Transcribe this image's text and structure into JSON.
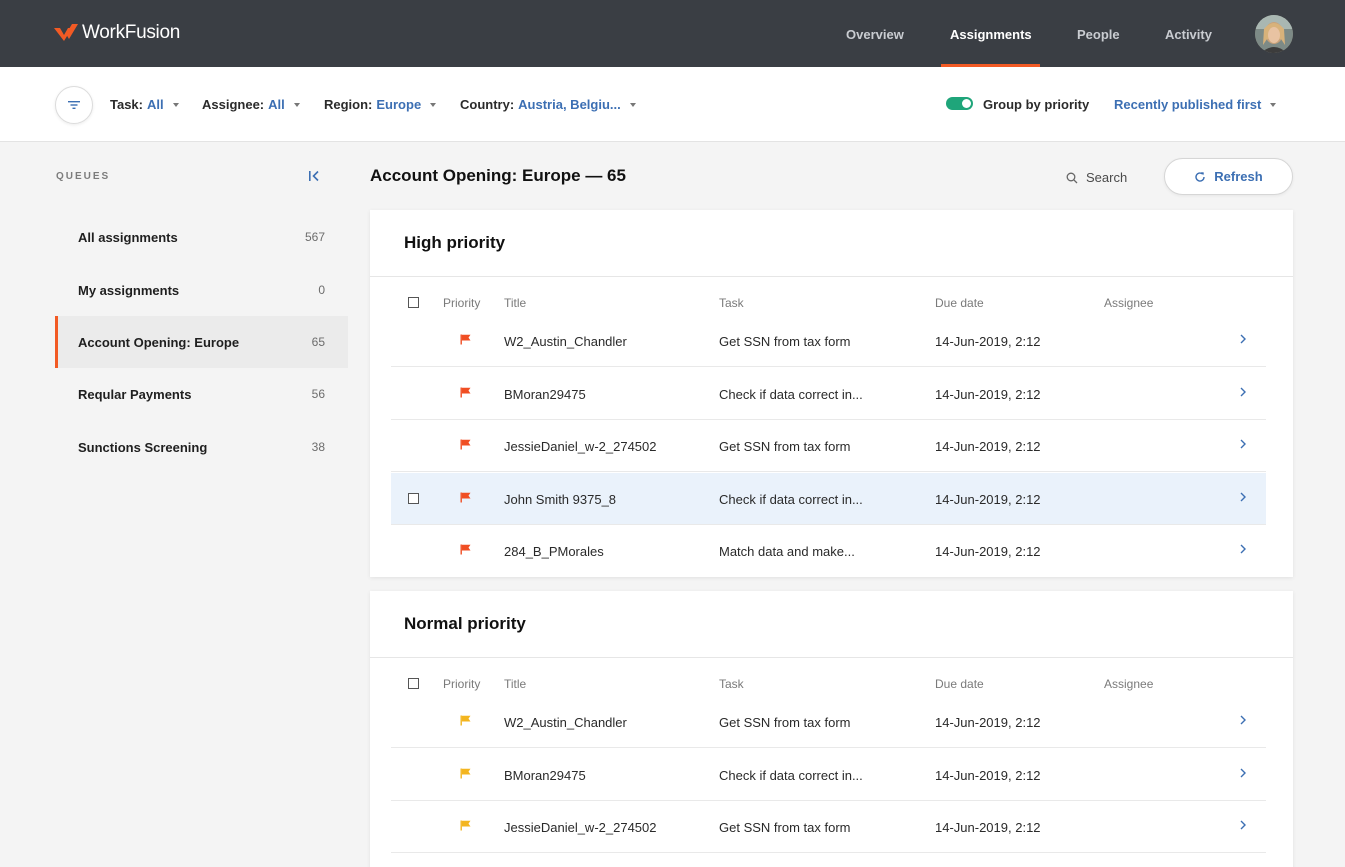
{
  "brand": {
    "name": "WorkFusion",
    "accent": "#f25a24",
    "link_color": "#3c6fb3"
  },
  "nav": [
    {
      "label": "Overview",
      "active": false
    },
    {
      "label": "Assignments",
      "active": true
    },
    {
      "label": "People",
      "active": false
    },
    {
      "label": "Activity",
      "active": false
    }
  ],
  "filters": {
    "task": {
      "label": "Task:",
      "value": "All"
    },
    "assignee": {
      "label": "Assignee:",
      "value": "All"
    },
    "region": {
      "label": "Region:",
      "value": "Europe"
    },
    "country": {
      "label": "Country:",
      "value": "Austria, Belgiu..."
    },
    "group_by_priority": {
      "label": "Group by priority",
      "enabled": true
    },
    "sort": "Recently published first"
  },
  "sidebar": {
    "title": "QUEUES",
    "items": [
      {
        "label": "All assignments",
        "count": "567",
        "active": false
      },
      {
        "label": "My assignments",
        "count": "0",
        "active": false
      },
      {
        "label": "Account Opening: Europe",
        "count": "65",
        "active": true
      },
      {
        "label": "Reqular Payments",
        "count": "56",
        "active": false
      },
      {
        "label": "Sunctions Screening",
        "count": "38",
        "active": false
      }
    ]
  },
  "main": {
    "title": "Account Opening: Europe — 65",
    "search_label": "Search",
    "refresh_label": "Refresh",
    "columns": {
      "priority": "Priority",
      "title": "Title",
      "task": "Task",
      "due": "Due date",
      "assignee": "Assignee"
    },
    "groups": [
      {
        "title": "High priority",
        "flag_color": "#f04e23",
        "rows": [
          {
            "title": "W2_Austin_Chandler",
            "task": "Get SSN from tax form",
            "due": "14-Jun-2019, 2:12",
            "assignee": "",
            "highlighted": false,
            "checkbox": false
          },
          {
            "title": "BMoran29475",
            "task": "Check if data correct in...",
            "due": "14-Jun-2019, 2:12",
            "assignee": "",
            "highlighted": false,
            "checkbox": false
          },
          {
            "title": "JessieDaniel_w-2_274502",
            "task": "Get SSN from tax form",
            "due": "14-Jun-2019, 2:12",
            "assignee": "",
            "highlighted": false,
            "checkbox": false
          },
          {
            "title": "John Smith 9375_8",
            "task": "Check if data correct in...",
            "due": "14-Jun-2019, 2:12",
            "assignee": "",
            "highlighted": true,
            "checkbox": true
          },
          {
            "title": "284_B_PMorales",
            "task": "Match data and make...",
            "due": "14-Jun-2019, 2:12",
            "assignee": "",
            "highlighted": false,
            "checkbox": false
          }
        ]
      },
      {
        "title": "Normal priority",
        "flag_color": "#f3b51f",
        "rows": [
          {
            "title": "W2_Austin_Chandler",
            "task": "Get SSN from tax form",
            "due": "14-Jun-2019, 2:12",
            "assignee": "",
            "highlighted": false,
            "checkbox": false
          },
          {
            "title": "BMoran29475",
            "task": "Check if data correct in...",
            "due": "14-Jun-2019, 2:12",
            "assignee": "",
            "highlighted": false,
            "checkbox": false
          },
          {
            "title": "JessieDaniel_w-2_274502",
            "task": "Get SSN from tax form",
            "due": "14-Jun-2019, 2:12",
            "assignee": "",
            "highlighted": false,
            "checkbox": false
          }
        ]
      }
    ]
  }
}
